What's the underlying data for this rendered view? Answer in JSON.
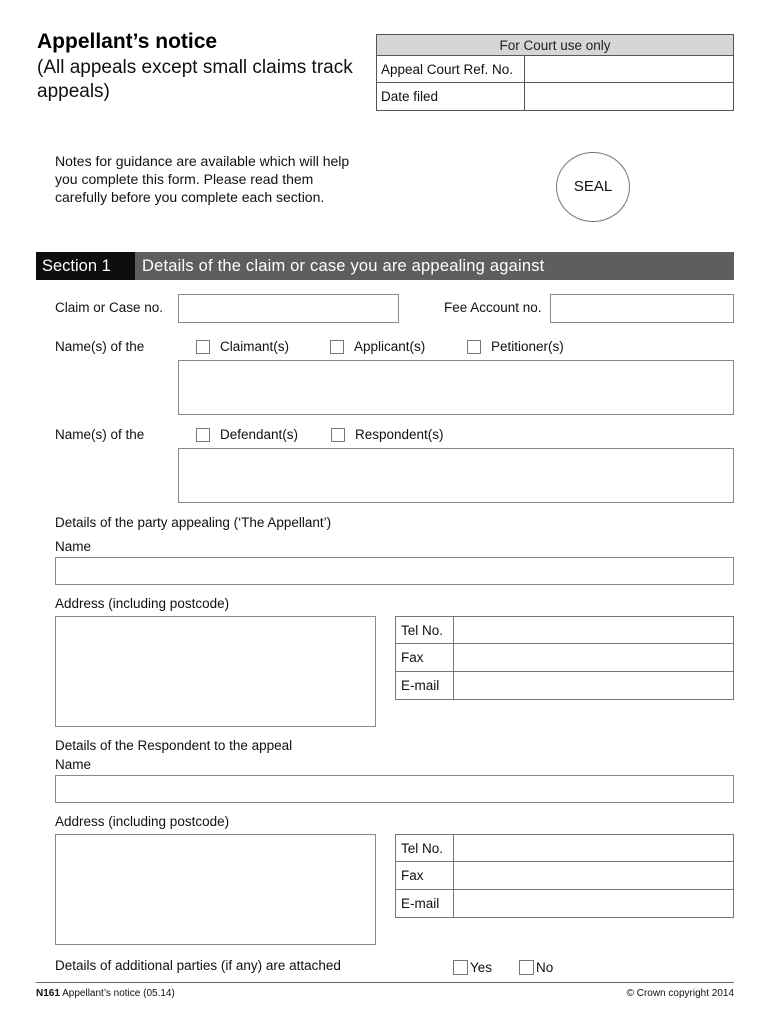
{
  "header": {
    "title": "Appellant’s notice",
    "subtitle": "(All appeals except small claims track appeals)"
  },
  "court_use": {
    "heading": "For Court use only",
    "rows": [
      {
        "label": "Appeal Court Ref. No.",
        "value": ""
      },
      {
        "label": "Date filed",
        "value": ""
      }
    ]
  },
  "notes": "Notes for guidance are available which will help you complete this form. Please read them carefully before you complete each section.",
  "seal": "SEAL",
  "section1": {
    "number": "Section 1",
    "title": "Details of the claim or case you are appealing against",
    "claim_case_label": "Claim or Case no.",
    "claim_case_value": "",
    "fee_account_label": "Fee Account no.",
    "fee_account_value": "",
    "names_group1": {
      "label": "Name(s) of the",
      "options": [
        {
          "label": "Claimant(s)",
          "checked": false
        },
        {
          "label": "Applicant(s)",
          "checked": false
        },
        {
          "label": "Petitioner(s)",
          "checked": false
        }
      ],
      "value": ""
    },
    "names_group2": {
      "label": "Name(s) of the",
      "options": [
        {
          "label": "Defendant(s)",
          "checked": false
        },
        {
          "label": "Respondent(s)",
          "checked": false
        }
      ],
      "value": ""
    },
    "appellant": {
      "heading": "Details of the party appealing (‘The Appellant’)",
      "name_label": "Name",
      "name_value": "",
      "address_label": "Address (including postcode)",
      "address_value": "",
      "contacts": [
        {
          "label": "Tel No.",
          "value": ""
        },
        {
          "label": "Fax",
          "value": ""
        },
        {
          "label": "E-mail",
          "value": ""
        }
      ]
    },
    "respondent": {
      "heading": "Details of the Respondent to the appeal",
      "name_label": "Name",
      "name_value": "",
      "address_label": "Address (including postcode)",
      "address_value": "",
      "contacts": [
        {
          "label": "Tel No.",
          "value": ""
        },
        {
          "label": "Fax",
          "value": ""
        },
        {
          "label": "E-mail",
          "value": ""
        }
      ]
    },
    "additional_parties": {
      "label": "Details of additional parties (if any) are attached",
      "yes_label": "Yes",
      "no_label": "No"
    }
  },
  "footer": {
    "form_code": "N161",
    "form_name": " Appellant’s notice (05.14)",
    "copyright": "© Crown copyright 2014"
  }
}
